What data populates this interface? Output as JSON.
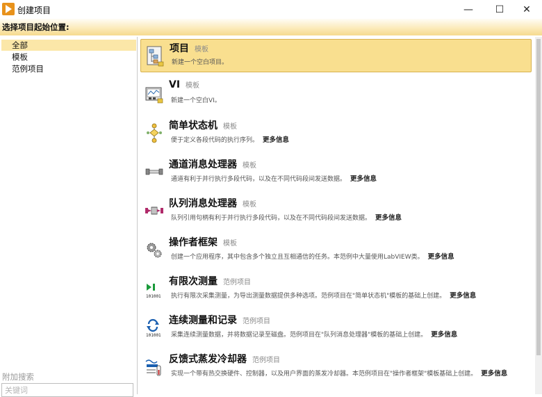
{
  "window": {
    "title": "创建项目",
    "minimize": "—",
    "maximize": "☐",
    "close": "✕"
  },
  "prompt": "选择项目起始位置:",
  "categories": [
    {
      "label": "全部",
      "selected": true
    },
    {
      "label": "模板",
      "selected": false
    },
    {
      "label": "范例项目",
      "selected": false
    }
  ],
  "search": {
    "label": "附加搜索",
    "placeholder": "关键词"
  },
  "templates": [
    {
      "title": "项目",
      "type": "模板",
      "desc": "新建一个空白项目。",
      "more": "",
      "icon": "project-icon",
      "selected": true
    },
    {
      "title": "VI",
      "type": "模板",
      "desc": "新建一个空白VI。",
      "more": "",
      "icon": "vi-icon",
      "selected": false
    },
    {
      "title": "简单状态机",
      "type": "模板",
      "desc": "便于定义各段代码的执行序列。",
      "more": "更多信息",
      "icon": "state-machine-icon",
      "selected": false
    },
    {
      "title": "通道消息处理器",
      "type": "模板",
      "desc": "通道有利于并行执行多段代码，以及在不同代码段间发送数据。",
      "more": "更多信息",
      "icon": "channel-icon",
      "selected": false
    },
    {
      "title": "队列消息处理器",
      "type": "模板",
      "desc": "队列引用句柄有利于并行执行多段代码，以及在不同代码段间发送数据。",
      "more": "更多信息",
      "icon": "queue-icon",
      "selected": false
    },
    {
      "title": "操作者框架",
      "type": "模板",
      "desc": "创建一个应用程序，其中包含多个独立且互相通信的任务。本范例中大量使用LabVIEW类。",
      "more": "更多信息",
      "icon": "gears-icon",
      "selected": false
    },
    {
      "title": "有限次测量",
      "type": "范例项目",
      "desc": "执行有限次采集测量，为导出测量数据提供多种选项。范例项目在\"简单状态机\"模板的基础上创建。",
      "more": "更多信息",
      "icon": "finite-measurement-icon",
      "selected": false
    },
    {
      "title": "连续测量和记录",
      "type": "范例项目",
      "desc": "采集连续测量数据，并将数据记录至磁盘。范例项目在\"队列消息处理器\"模板的基础上创建。",
      "more": "更多信息",
      "icon": "continuous-measurement-icon",
      "selected": false
    },
    {
      "title": "反馈式蒸发冷却器",
      "type": "范例项目",
      "desc": "实现一个带有热交换硬件、控制器，以及用户界面的蒸发冷却器。本范例项目在\"操作者框架\"模板基础上创建。",
      "more": "更多信息",
      "icon": "cooler-icon",
      "selected": false
    }
  ],
  "colors": {
    "selection_fill": "#f9df8f",
    "selection_border": "#d7b14d",
    "app_icon": "#e8921b"
  }
}
